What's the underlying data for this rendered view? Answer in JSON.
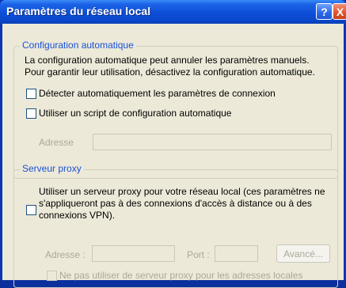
{
  "window": {
    "title": "Paramètres du réseau local",
    "help_label": "?",
    "close_label": "X"
  },
  "auto_config": {
    "legend": "Configuration automatique",
    "description_line1": "La configuration automatique peut annuler les paramètres manuels.",
    "description_line2": "Pour garantir leur utilisation, désactivez la configuration automatique.",
    "detect_label": "Détecter automatiquement les paramètres de connexion",
    "detect_checked": false,
    "script_label": "Utiliser un script de configuration automatique",
    "script_checked": false,
    "address_label": "Adresse",
    "address_value": ""
  },
  "proxy": {
    "legend": "Serveur proxy",
    "use_proxy_line1": "Utiliser un serveur proxy pour votre réseau local (ces paramètres ne",
    "use_proxy_line2": "s'appliqueront pas à des connexions d'accès à distance ou à des",
    "use_proxy_line3": "connexions VPN).",
    "use_proxy_checked": false,
    "address_label": "Adresse :",
    "address_value": "",
    "port_label": "Port :",
    "port_value": "",
    "advanced_label": "Avancé...",
    "bypass_label": "Ne pas utiliser de serveur proxy pour les adresses locales",
    "bypass_checked": false
  }
}
